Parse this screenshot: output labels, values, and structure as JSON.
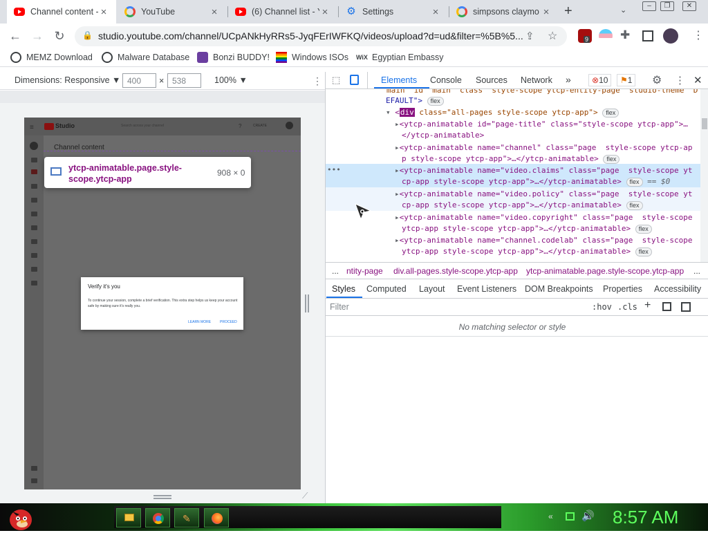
{
  "browser": {
    "tabs": [
      {
        "title": "Channel content -",
        "icon": "youtube-icon",
        "active": true
      },
      {
        "title": "YouTube",
        "icon": "google-icon",
        "active": false
      },
      {
        "title": "(6) Channel list - Y",
        "icon": "youtube-icon",
        "active": false
      },
      {
        "title": "Settings",
        "icon": "gear-icon",
        "active": false
      },
      {
        "title": "simpsons claymo",
        "icon": "google-icon",
        "active": false
      }
    ],
    "new_tab": "+",
    "url": "studio.youtube.com/channel/UCpANkHyRRs5-JyqFErIWFKQ/videos/upload?d=ud&filter=%5B%5...",
    "extension_badge": "9",
    "bookmarks": [
      {
        "label": "MEMZ Download",
        "icon": "globe-icon"
      },
      {
        "label": "Malware Database",
        "icon": "globe-icon"
      },
      {
        "label": "Bonzi BUDDY!",
        "icon": "bonzi-icon"
      },
      {
        "label": "Windows ISOs",
        "icon": "rainbow-flag-icon"
      },
      {
        "label": "Egyptian Embassy",
        "icon": "wix-icon"
      }
    ]
  },
  "device_toolbar": {
    "dimensions_label": "Dimensions: Responsive ▼",
    "width": "400",
    "times": "×",
    "height": "538",
    "zoom": "100% ▼"
  },
  "page": {
    "studio_label": "Studio",
    "search_placeholder": "Search across your channel",
    "create_label": "CREATE",
    "channel_content": "Channel content",
    "tooltip": {
      "selector": "ytcp-animatable.page.style-scope.ytcp-app",
      "size": "908 × 0"
    },
    "verify": {
      "title": "Verify it's you",
      "body": "To continue your session, complete a brief verification. This extra step helps us keep your account safe by making sure it's really you.",
      "learn_more": "LEARN MORE",
      "proceed": "PROCEED"
    }
  },
  "devtools": {
    "tabs": [
      "Elements",
      "Console",
      "Sources",
      "Network"
    ],
    "more": "»",
    "errors": "10",
    "warnings": "1",
    "dom_lines": [
      {
        "text": "EFAULT\">",
        "pill": "flex"
      },
      {
        "tag": "div",
        "attrs": "class=\"all-pages style-scope ytcp-app\">",
        "pill": "flex"
      },
      {
        "line1": "<ytcp-animatable id=\"page-title\" class=\"style-scope ytcp-app\">…",
        "line2": "</ytcp-animatable>"
      },
      {
        "line1": "<ytcp-animatable name=\"channel\" class=\"page  style-scope ytcp-ap",
        "line2": "p style-scope ytcp-app\">…</ytcp-animatable>",
        "pill": "flex"
      },
      {
        "line1": "<ytcp-animatable name=\"video.claims\" class=\"page  style-scope yt",
        "line2": "cp-app style-scope ytcp-app\">…</ytcp-animatable>",
        "pill": "flex",
        "extra": "== $0"
      },
      {
        "line1": "<ytcp-animatable name=\"video.policy\" class=\"page  style-scope yt",
        "line2": "cp-app style-scope ytcp-app\">…</ytcp-animatable>",
        "pill": "flex"
      },
      {
        "line1": "<ytcp-animatable name=\"video.copyright\" class=\"page  style-scope",
        "line2": "ytcp-app style-scope ytcp-app\">…</ytcp-animatable>",
        "pill": "flex"
      },
      {
        "line1": "<ytcp-animatable name=\"channel.codelab\" class=\"page  style-scope",
        "line2": "ytcp-app style-scope ytcp-app\">…</ytcp-animatable>",
        "pill": "flex"
      }
    ],
    "breadcrumbs": [
      "...",
      "ntity-page",
      "div.all-pages.style-scope.ytcp-app",
      "ytcp-animatable.page.style-scope.ytcp-app",
      "..."
    ],
    "style_tabs": [
      "Styles",
      "Computed",
      "Layout",
      "Event Listeners",
      "DOM Breakpoints",
      "Properties",
      "Accessibility"
    ],
    "filter_placeholder": "Filter",
    "hov": ":hov",
    "cls": ".cls",
    "empty": "No matching selector or style"
  },
  "taskbar": {
    "clock": "8:57 AM"
  }
}
